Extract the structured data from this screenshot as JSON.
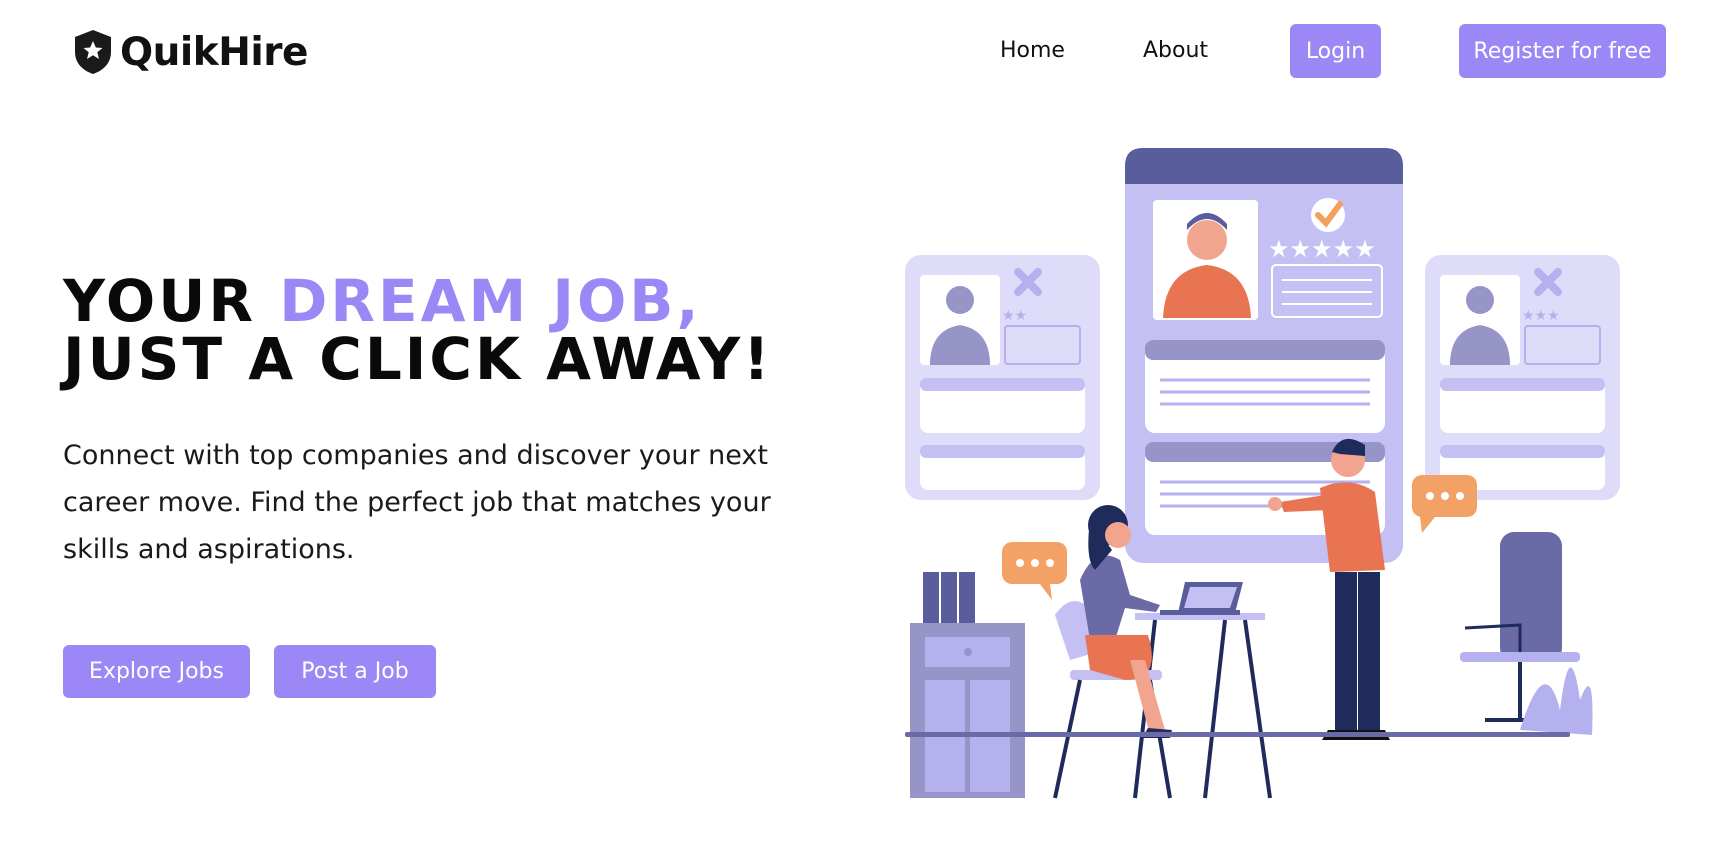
{
  "brand": {
    "name": "QuikHire",
    "logo_icon": "shield-star-icon"
  },
  "nav": {
    "home": "Home",
    "about": "About",
    "login": "Login",
    "register": "Register for free"
  },
  "hero": {
    "title_part1": "YOUR ",
    "title_accent": "DREAM JOB,",
    "title_line2": "JUST A CLICK AWAY!",
    "description": "Connect with top companies and discover your next career move. Find the perfect job that matches your skills and aspirations.",
    "explore_button": "Explore Jobs",
    "post_button": "Post a Job"
  },
  "colors": {
    "accent": "#9b87f5",
    "text": "#111111",
    "illustration_purple": "#c4c0f3",
    "illustration_dark": "#5a5d9c",
    "illustration_orange": "#e97451"
  },
  "illustration": {
    "name": "job-search-illustration"
  }
}
